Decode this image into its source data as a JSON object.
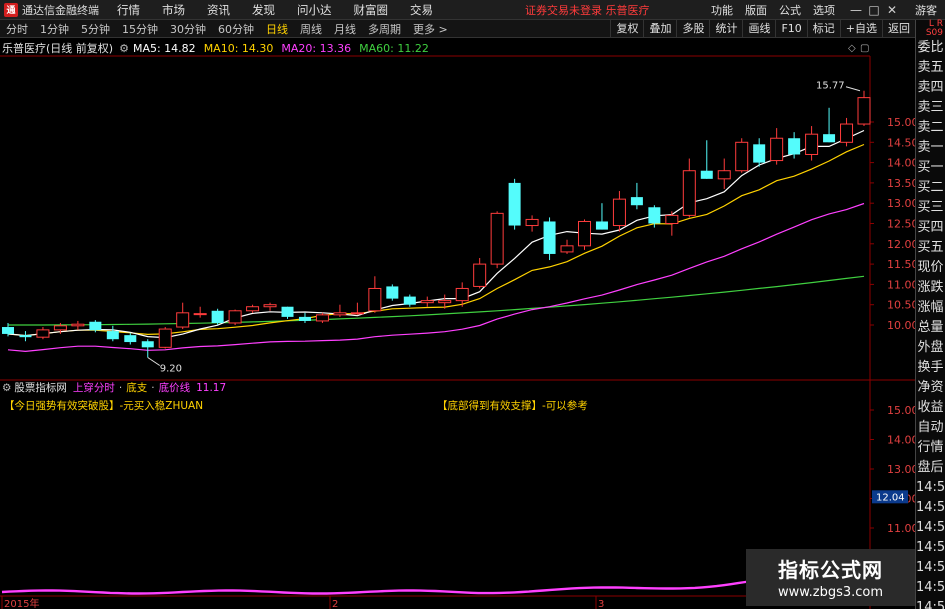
{
  "titlebar": {
    "title": "通达信金融终端",
    "menu": [
      "行情",
      "市场",
      "资讯",
      "发现",
      "问小达",
      "财富圈",
      "交易"
    ],
    "notice": "证券交易未登录  乐普医疗",
    "right_links": [
      "功能",
      "版面",
      "公式",
      "选项"
    ],
    "guest": "游客"
  },
  "toolbar": {
    "periods": [
      "分时",
      "1分钟",
      "5分钟",
      "15分钟",
      "30分钟",
      "60分钟",
      "日线",
      "周线",
      "月线",
      "多周期",
      "更多 >"
    ],
    "tools": [
      "复权",
      "叠加",
      "多股",
      "统计",
      "画线",
      "F10",
      "标记",
      "+自选",
      "返回"
    ]
  },
  "legend": {
    "stock": "乐普医疗(日线 前复权)",
    "ma5": "MA5: 14.82",
    "ma10": "MA10: 14.30",
    "ma20": "MA20: 13.36",
    "ma60": "MA60: 11.22",
    "colors": {
      "ma5": "#ffffff",
      "ma10": "#ffd200",
      "ma20": "#ff40ff",
      "ma60": "#40d040"
    }
  },
  "price_axis": [
    "15.00",
    "14.50",
    "14.00",
    "13.50",
    "13.00",
    "12.50",
    "12.00",
    "11.50",
    "11.00",
    "10.50",
    "10.00"
  ],
  "annotations": {
    "high": "15.77",
    "low": "9.20"
  },
  "indicator": {
    "name": "股票指标网",
    "parts": [
      "上穿分时",
      "·",
      "底支",
      "·",
      "底价线",
      "11.17"
    ],
    "signal1": "【今日强势有效突破股】-元买入稳ZHUAN",
    "signal2": "【底部得到有效支撑】-可以参考",
    "axis": [
      "15.00",
      "14.00",
      "13.00",
      "12.00",
      "11.00"
    ],
    "current": "12.04"
  },
  "x_axis": [
    "2015年",
    "2",
    "3"
  ],
  "sidepanel": {
    "top": "L R S09",
    "items": [
      "委比",
      "卖五",
      "卖四",
      "卖三",
      "卖二",
      "卖一",
      "买一",
      "买二",
      "买三",
      "买四",
      "买五",
      "现价",
      "涨跌",
      "涨幅",
      "总量",
      "外盘",
      "换手",
      "净资",
      "收益",
      "自动",
      "行情",
      "盘后",
      "14:5",
      "14:5",
      "14:5",
      "14:5",
      "14:5",
      "14:5",
      "14:5",
      "14:5",
      "14:5"
    ]
  },
  "watermark": {
    "line1": "指标公式网",
    "line2": "www.zbgs3.com"
  },
  "chart_data": {
    "type": "candlestick",
    "y_range": [
      9.0,
      16.0
    ],
    "candles": [
      {
        "o": 9.95,
        "h": 10.05,
        "l": 9.72,
        "c": 9.78
      },
      {
        "o": 9.75,
        "h": 9.85,
        "l": 9.6,
        "c": 9.7
      },
      {
        "o": 9.7,
        "h": 9.95,
        "l": 9.65,
        "c": 9.88
      },
      {
        "o": 9.88,
        "h": 10.05,
        "l": 9.78,
        "c": 9.98
      },
      {
        "o": 9.98,
        "h": 10.1,
        "l": 9.88,
        "c": 10.02
      },
      {
        "o": 10.08,
        "h": 10.12,
        "l": 9.82,
        "c": 9.87
      },
      {
        "o": 9.85,
        "h": 9.98,
        "l": 9.6,
        "c": 9.65
      },
      {
        "o": 9.75,
        "h": 9.8,
        "l": 9.52,
        "c": 9.58
      },
      {
        "o": 9.6,
        "h": 9.65,
        "l": 9.2,
        "c": 9.45
      },
      {
        "o": 9.45,
        "h": 9.95,
        "l": 9.42,
        "c": 9.9
      },
      {
        "o": 9.95,
        "h": 10.55,
        "l": 9.9,
        "c": 10.3
      },
      {
        "o": 10.28,
        "h": 10.45,
        "l": 10.18,
        "c": 10.28
      },
      {
        "o": 10.35,
        "h": 10.4,
        "l": 10.0,
        "c": 10.05
      },
      {
        "o": 10.05,
        "h": 10.38,
        "l": 10.0,
        "c": 10.35
      },
      {
        "o": 10.35,
        "h": 10.5,
        "l": 10.3,
        "c": 10.45
      },
      {
        "o": 10.45,
        "h": 10.55,
        "l": 10.35,
        "c": 10.5
      },
      {
        "o": 10.45,
        "h": 10.45,
        "l": 10.15,
        "c": 10.2
      },
      {
        "o": 10.2,
        "h": 10.3,
        "l": 10.05,
        "c": 10.1
      },
      {
        "o": 10.1,
        "h": 10.3,
        "l": 10.05,
        "c": 10.25
      },
      {
        "o": 10.25,
        "h": 10.5,
        "l": 10.2,
        "c": 10.3
      },
      {
        "o": 10.3,
        "h": 10.55,
        "l": 10.25,
        "c": 10.3
      },
      {
        "o": 10.35,
        "h": 11.2,
        "l": 10.3,
        "c": 10.9
      },
      {
        "o": 10.95,
        "h": 11.0,
        "l": 10.6,
        "c": 10.65
      },
      {
        "o": 10.7,
        "h": 10.75,
        "l": 10.45,
        "c": 10.5
      },
      {
        "o": 10.55,
        "h": 10.7,
        "l": 10.45,
        "c": 10.6
      },
      {
        "o": 10.55,
        "h": 10.75,
        "l": 10.4,
        "c": 10.6
      },
      {
        "o": 10.6,
        "h": 11.05,
        "l": 10.45,
        "c": 10.9
      },
      {
        "o": 10.95,
        "h": 11.65,
        "l": 10.9,
        "c": 11.5
      },
      {
        "o": 11.5,
        "h": 12.8,
        "l": 11.4,
        "c": 12.75
      },
      {
        "o": 13.5,
        "h": 13.6,
        "l": 12.35,
        "c": 12.45
      },
      {
        "o": 12.45,
        "h": 12.7,
        "l": 12.3,
        "c": 12.6
      },
      {
        "o": 12.55,
        "h": 12.65,
        "l": 11.6,
        "c": 11.75
      },
      {
        "o": 11.8,
        "h": 12.1,
        "l": 11.75,
        "c": 11.95
      },
      {
        "o": 11.95,
        "h": 12.6,
        "l": 11.85,
        "c": 12.55
      },
      {
        "o": 12.55,
        "h": 13.0,
        "l": 12.35,
        "c": 12.35
      },
      {
        "o": 12.45,
        "h": 13.3,
        "l": 12.3,
        "c": 13.1
      },
      {
        "o": 13.15,
        "h": 13.5,
        "l": 12.85,
        "c": 12.95
      },
      {
        "o": 12.9,
        "h": 12.95,
        "l": 12.4,
        "c": 12.5
      },
      {
        "o": 12.5,
        "h": 12.8,
        "l": 12.2,
        "c": 12.7
      },
      {
        "o": 12.7,
        "h": 14.1,
        "l": 12.65,
        "c": 13.8
      },
      {
        "o": 13.8,
        "h": 14.55,
        "l": 13.6,
        "c": 13.6
      },
      {
        "o": 13.6,
        "h": 14.1,
        "l": 13.35,
        "c": 13.8
      },
      {
        "o": 13.8,
        "h": 14.6,
        "l": 13.75,
        "c": 14.5
      },
      {
        "o": 14.45,
        "h": 14.6,
        "l": 13.9,
        "c": 14.0
      },
      {
        "o": 14.05,
        "h": 14.85,
        "l": 13.95,
        "c": 14.6
      },
      {
        "o": 14.6,
        "h": 14.75,
        "l": 14.1,
        "c": 14.2
      },
      {
        "o": 14.2,
        "h": 14.9,
        "l": 14.05,
        "c": 14.7
      },
      {
        "o": 14.7,
        "h": 15.35,
        "l": 14.5,
        "c": 14.5
      },
      {
        "o": 14.5,
        "h": 15.1,
        "l": 14.4,
        "c": 14.95
      },
      {
        "o": 14.95,
        "h": 15.77,
        "l": 14.9,
        "c": 15.6
      }
    ]
  }
}
